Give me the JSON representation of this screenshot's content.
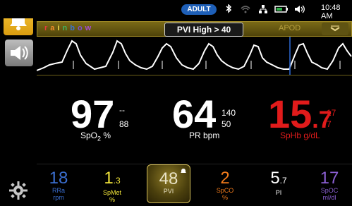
{
  "status_bar": {
    "profile": "ADULT",
    "time": "10:48 AM",
    "icons": [
      "bluetooth-icon",
      "wifi-icon",
      "network-icon",
      "battery-icon",
      "volume-icon"
    ]
  },
  "left_rail": {
    "icons": [
      "alarm-bell-icon",
      "speaker-icon",
      "gear-icon"
    ]
  },
  "header": {
    "brand": "rainbow",
    "alarm_text": "PVI High > 40",
    "apod": "APOD",
    "menu_icon": "chevron-down-icon"
  },
  "colors": {
    "accent_gold": "#d4b647",
    "alarm_yellow": "#f7c73a",
    "sphb_red": "#e11b1b",
    "spco_orange": "#f07a1b",
    "rra_blue": "#3b6fd1",
    "spoc_purple": "#8b5fd3"
  },
  "parameters": {
    "spo2": {
      "value": "97",
      "hi": "--",
      "lo": "88",
      "label": "SpO",
      "sub": "2",
      "unit": "%"
    },
    "pr": {
      "value": "64",
      "hi": "140",
      "lo": "50",
      "label": "PR bpm"
    },
    "sphb": {
      "value_int": "15",
      "value_dec": ".7",
      "hi": "17",
      "lo": "7",
      "label": "SpHb g/dL"
    }
  },
  "bottom": [
    {
      "id": "rra",
      "value": "18",
      "l1": "RRa",
      "l2": "rpm"
    },
    {
      "id": "spmet",
      "value": "1",
      "dec": ".3",
      "l1": "SpMet",
      "l2": "%"
    },
    {
      "id": "pvi",
      "value": "48",
      "l1": "PVI",
      "l2": ""
    },
    {
      "id": "spco",
      "value": "2",
      "l1": "SpCO",
      "l2": "%"
    },
    {
      "id": "pi",
      "value": "5",
      "dec": ".7",
      "l1": "PI",
      "l2": ""
    },
    {
      "id": "spoc",
      "value": "17",
      "l1": "SpOC",
      "l2": "ml/dl"
    }
  ]
}
